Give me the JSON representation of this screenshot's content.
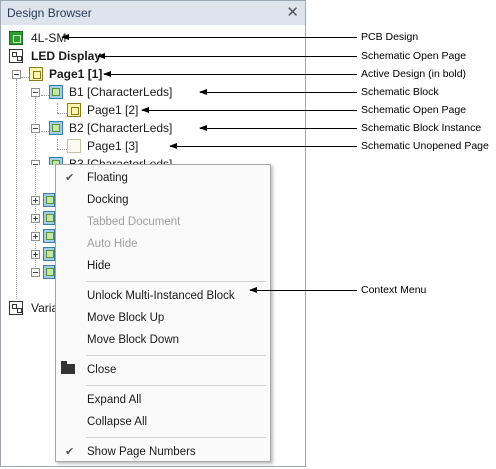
{
  "panel": {
    "title": "Design Browser",
    "close_glyph": "✕"
  },
  "tree": {
    "pcb": {
      "label": "4L-SM",
      "icon": "pcb-icon"
    },
    "led": {
      "label": "LED Display",
      "icon": "schematic-project-icon"
    },
    "page1": {
      "label": "Page1 [1]",
      "icon": "schematic-page-icon"
    },
    "b1": {
      "label": "B1 [CharacterLeds]",
      "icon": "block-icon"
    },
    "b1_page": {
      "label": "Page1 [2]",
      "icon": "schematic-page-icon"
    },
    "b2": {
      "label": "B2 [CharacterLeds]",
      "icon": "block-icon"
    },
    "b2_page": {
      "label": "Page1 [3]",
      "icon": "unopened-page-icon"
    },
    "b3": {
      "label": "B3 [CharacterLeds]",
      "icon": "block-icon"
    },
    "variants": {
      "label": "Varia",
      "icon": "variants-icon"
    }
  },
  "menu": {
    "floating": "Floating",
    "docking": "Docking",
    "tabbed": "Tabbed Document",
    "autohide": "Auto Hide",
    "hide": "Hide",
    "unlock": "Unlock Multi-Instanced Block",
    "moveup": "Move Block Up",
    "movedown": "Move Block Down",
    "close": "Close",
    "expand": "Expand All",
    "collapse": "Collapse All",
    "pagenums": "Show Page Numbers",
    "check_glyph": "✔"
  },
  "annotations": {
    "pcb": "PCB Design",
    "schematic_open_page": "Schematic Open Page",
    "active": "Active Design (in bold)",
    "schematic_block": "Schematic Block",
    "schematic_open_page_2": "Schematic Open Page",
    "block_instance": "Schematic Block Instance",
    "unopened": "Schematic Unopened Page",
    "context_menu": "Context Menu"
  }
}
